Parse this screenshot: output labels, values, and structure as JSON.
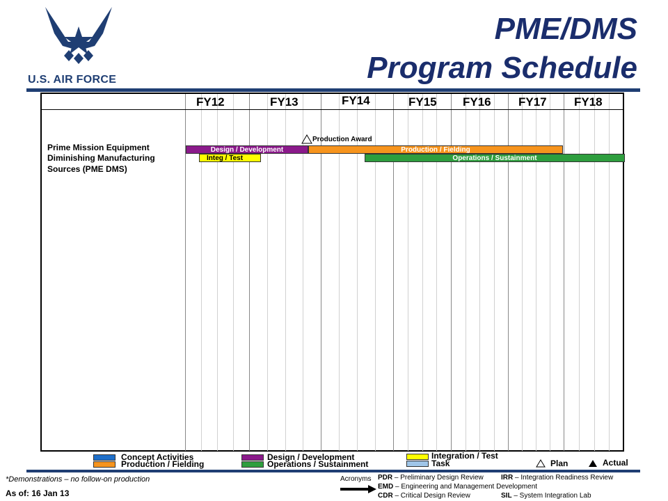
{
  "header": {
    "logo_text": "U.S. AIR FORCE",
    "title_line1": "PME/DMS",
    "title_line2": "Program Schedule"
  },
  "chart_data": {
    "type": "gantt",
    "fiscal_years": [
      "FY12",
      "FY13",
      "FY14",
      "FY15",
      "FY16",
      "FY17",
      "FY18"
    ],
    "program": {
      "lines": [
        "Prime Mission Equipment",
        "Diminishing Manufacturing",
        "Sources (PME DMS)"
      ]
    },
    "bars": [
      {
        "label": "Design / Development",
        "color": "#8b1a8b",
        "start": "FY12 Q1",
        "end": "FY14 Q1"
      },
      {
        "label": "Production / Fielding",
        "color": "#f7941d",
        "start": "FY14 Q1",
        "end": "FY17 Q4"
      },
      {
        "label": "Integ / Test",
        "color": "#ffff00",
        "start": "FY12 Q1",
        "end": "FY12 Q4"
      },
      {
        "label": "Operations / Sustainment",
        "color": "#2e9e3e",
        "start": "FY14 Q3",
        "end": "FY18 Q4"
      }
    ],
    "milestones": [
      {
        "label": "Production Award",
        "type": "plan",
        "at": "FY14 Q1"
      }
    ]
  },
  "legend": {
    "items": [
      {
        "label": "Concept Activities",
        "color": "#1f6fc9"
      },
      {
        "label": "Production / Fielding",
        "color": "#f7941d"
      },
      {
        "label": "Design / Development",
        "color": "#8b1a8b"
      },
      {
        "label": "Operations / Sustainment",
        "color": "#2e9e3e"
      },
      {
        "label": "Integration / Test",
        "color": "#ffff00"
      },
      {
        "label": "Task",
        "color": "#9fc5e8"
      }
    ],
    "plan": "Plan",
    "actual": "Actual"
  },
  "footer": {
    "footnote": "*Demonstrations – no follow-on production",
    "as_of": "As of: 16 Jan 13",
    "acronyms_label": "Acronyms",
    "acronyms": [
      {
        "abbr": "PDR",
        "text": "– Preliminary Design Review"
      },
      {
        "abbr": "IRR",
        "text": "– Integration Readiness Review"
      },
      {
        "abbr": "EMD",
        "text": "– Engineering and Management Development"
      },
      {
        "abbr": "CDR",
        "text": "– Critical Design Review"
      },
      {
        "abbr": "SIL",
        "text": "– System Integration Lab"
      }
    ]
  }
}
